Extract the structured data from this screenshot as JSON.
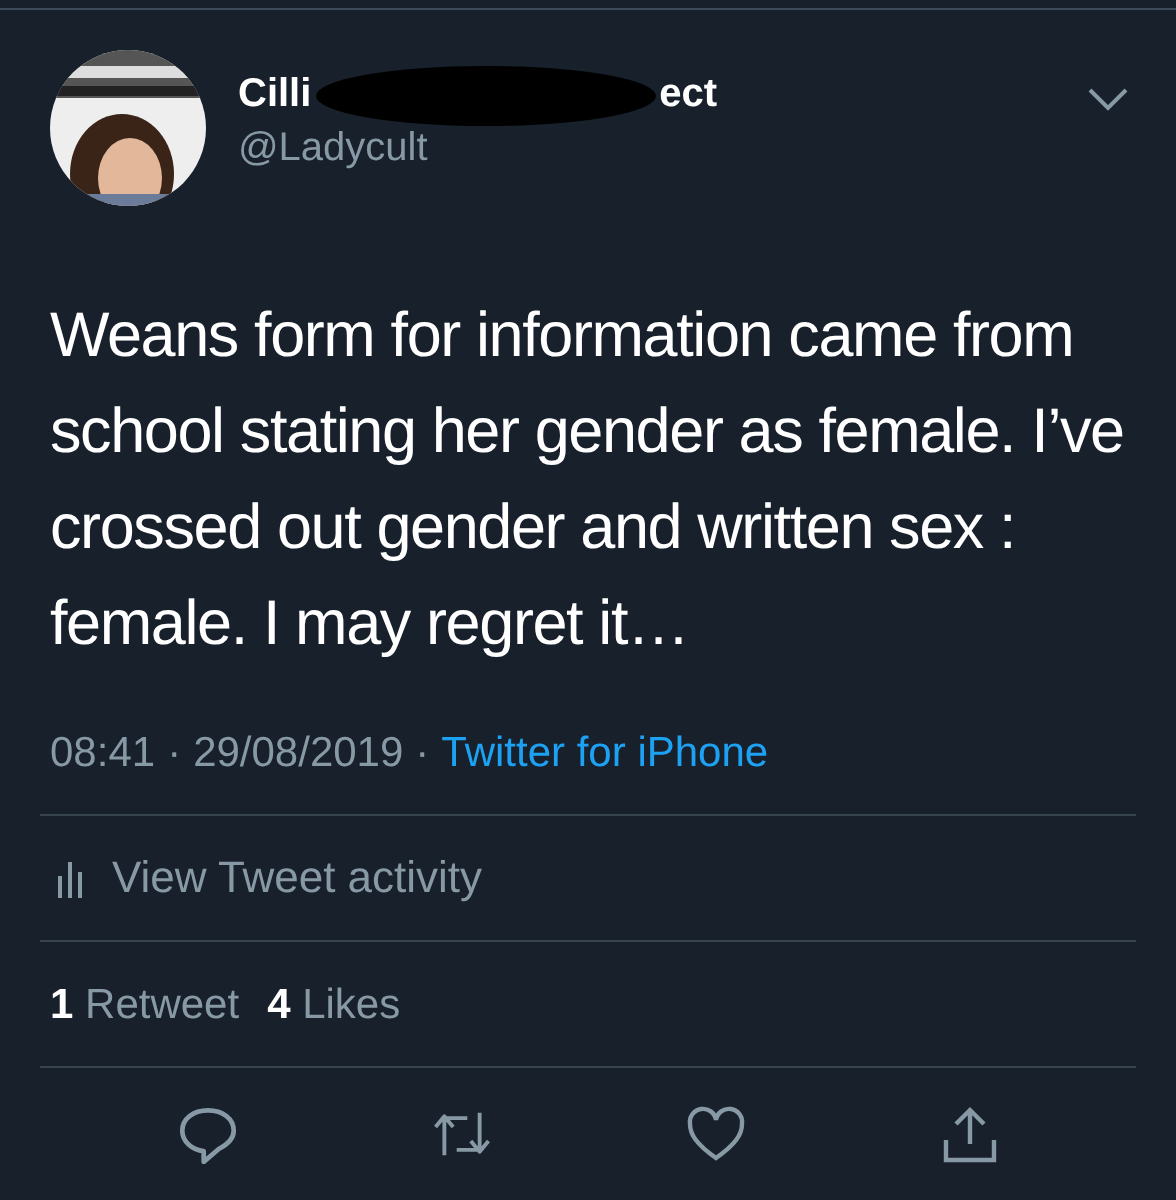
{
  "author": {
    "name_start": "Cilli",
    "name_end": "ect",
    "handle": "@Ladycult",
    "redacted": true
  },
  "tweet": {
    "text": "Weans form for information came from school stating her gender as female. I’ve crossed out gender and written sex : female. I may regret it…"
  },
  "meta": {
    "time": "08:41",
    "date": "29/08/2019",
    "separator": "·",
    "source": "Twitter for iPhone"
  },
  "activity": {
    "label": "View Tweet activity"
  },
  "stats": [
    {
      "count": "1",
      "label": "Retweet"
    },
    {
      "count": "4",
      "label": "Likes"
    }
  ],
  "actions": [
    {
      "kind": "reply"
    },
    {
      "kind": "retweet"
    },
    {
      "kind": "like"
    },
    {
      "kind": "share"
    }
  ]
}
